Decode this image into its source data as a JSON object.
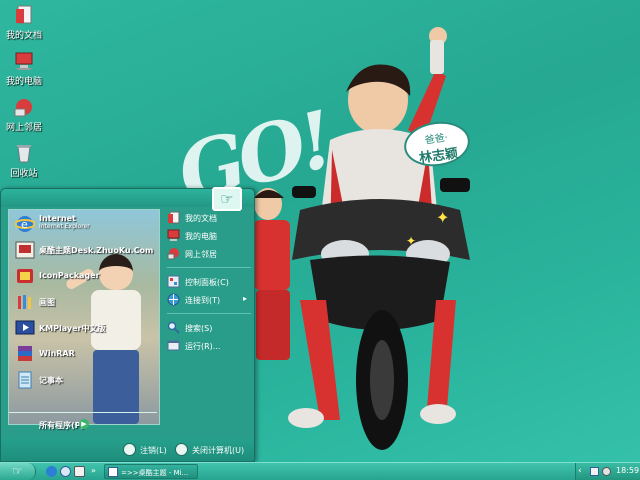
{
  "wallpaper": {
    "go_text": "GO!",
    "bubble_line1": "爸爸·",
    "bubble_line2": "林志颖"
  },
  "desktop_icons": [
    {
      "label": "我的文档",
      "icon": "my-documents-icon"
    },
    {
      "label": "我的电脑",
      "icon": "my-computer-icon"
    },
    {
      "label": "网上邻居",
      "icon": "network-places-icon"
    },
    {
      "label": "回收站",
      "icon": "recycle-bin-icon"
    }
  ],
  "start_menu": {
    "programs": [
      {
        "title": "Internet",
        "subtitle": "Internet Explorer",
        "icon": "internet-explorer-icon"
      },
      {
        "title": "桌酷主题Desk.ZhuoKu.Com",
        "subtitle": "",
        "icon": "zhuoku-theme-icon"
      },
      {
        "title": "IconPackager",
        "subtitle": "",
        "icon": "iconpackager-icon"
      },
      {
        "title": "画图",
        "subtitle": "",
        "icon": "paint-icon"
      },
      {
        "title": "KMPlayer中文版",
        "subtitle": "",
        "icon": "kmplayer-icon"
      },
      {
        "title": "WinRAR",
        "subtitle": "",
        "icon": "winrar-icon"
      },
      {
        "title": "记事本",
        "subtitle": "",
        "icon": "notepad-icon"
      }
    ],
    "all_programs": "所有程序(P)",
    "places": [
      {
        "label": "我的文档",
        "icon": "my-documents-icon"
      },
      {
        "label": "我的电脑",
        "icon": "my-computer-icon"
      },
      {
        "label": "网上邻居",
        "icon": "network-places-icon"
      }
    ],
    "settings": [
      {
        "label": "控制面板(C)",
        "icon": "control-panel-icon"
      },
      {
        "label": "连接到(T)",
        "icon": "connect-to-icon"
      }
    ],
    "tools": [
      {
        "label": "搜索(S)",
        "icon": "search-icon"
      },
      {
        "label": "运行(R)...",
        "icon": "run-icon"
      }
    ],
    "logoff": "注销(L)",
    "shutdown": "关闭计算机(U)"
  },
  "taskbar": {
    "task_label": "=>>桌酷主题 - Mi...",
    "clock": "18:59"
  },
  "colors": {
    "accent": "#2a9c8a",
    "taskbar": "#27a48f"
  }
}
